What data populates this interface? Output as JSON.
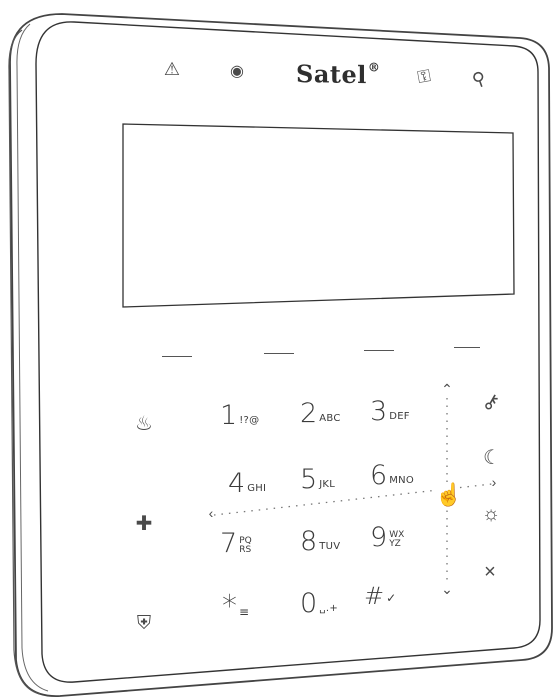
{
  "brand": {
    "name": "Satel",
    "mark": "®"
  },
  "status_icons": {
    "alarm": "⚠",
    "armed": "◉",
    "service": "⚿",
    "trouble": "⚲"
  },
  "keys": [
    {
      "digit": "1",
      "letters": "!?@"
    },
    {
      "digit": "2",
      "letters": "ABC"
    },
    {
      "digit": "3",
      "letters": "DEF"
    },
    {
      "digit": "4",
      "letters": "GHI"
    },
    {
      "digit": "5",
      "letters": "JKL"
    },
    {
      "digit": "6",
      "letters": "MNO"
    },
    {
      "digit": "7",
      "letters_top": "PQ",
      "letters_bottom": "RS"
    },
    {
      "digit": "8",
      "letters": "TUV"
    },
    {
      "digit": "9",
      "letters_top": "WX",
      "letters_bottom": "YZ"
    },
    {
      "digit": "*",
      "letters": "≡"
    },
    {
      "digit": "0",
      "letters": "␣.+"
    },
    {
      "digit": "#",
      "letters": "✓"
    }
  ],
  "side_icons": {
    "fire": "♨",
    "medical": "✚",
    "panic": "⛨"
  },
  "right_icons": {
    "key": "⚷",
    "night": "☾",
    "day": "☼",
    "cancel": "×"
  },
  "navigation": {
    "up": "⌃",
    "down": "⌄",
    "left": "‹",
    "right": "›",
    "touch": "☝"
  }
}
